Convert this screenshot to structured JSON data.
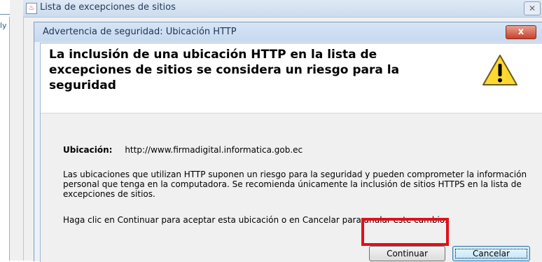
{
  "background_window": {
    "title": "Lista de excepciones de sitios",
    "side_text": "ly"
  },
  "dialog": {
    "title": "Advertencia de seguridad: Ubicación HTTP",
    "close_label": "x",
    "heading": "La inclusión de una ubicación HTTP en la lista de excepciones de sitios se considera un riesgo para la seguridad",
    "location_label": "Ubicación:",
    "location_value": "http://www.firmadigital.informatica.gob.ec",
    "paragraph1": "Las ubicaciones que utilizan HTTP suponen un riesgo para la seguridad y pueden comprometer la información personal que tenga en la computadora. Se recomienda únicamente la inclusión de sitios HTTPS en la lista de excepciones de sitios.",
    "paragraph2": "Haga clic en Continuar para aceptar esta ubicación o en Cancelar para anular este cambio.",
    "continue_label": "Continuar",
    "cancel_label": "Cancelar",
    "warning_icon": "warning-triangle-icon"
  },
  "colors": {
    "highlight": "#e0101a",
    "warning_yellow": "#ffd92f",
    "close_red": "#c7412b"
  }
}
